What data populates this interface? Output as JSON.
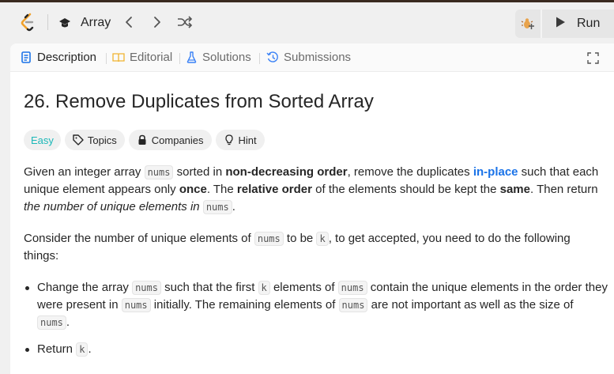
{
  "header": {
    "problem_nav_title": "Array",
    "run_label": "Run",
    "icons": [
      "logo-icon",
      "graduation-cap-icon",
      "chevron-left-icon",
      "chevron-right-icon",
      "shuffle-icon",
      "debug-icon",
      "play-icon"
    ]
  },
  "tabs": [
    {
      "label": "Description",
      "icon": "document-icon",
      "active": true
    },
    {
      "label": "Editorial",
      "icon": "book-icon",
      "active": false
    },
    {
      "label": "Solutions",
      "icon": "flask-icon",
      "active": false
    },
    {
      "label": "Submissions",
      "icon": "history-icon",
      "active": false
    }
  ],
  "problem": {
    "title": "26. Remove Duplicates from Sorted Array",
    "difficulty": "Easy",
    "tags": [
      "Topics",
      "Companies",
      "Hint"
    ]
  },
  "description": {
    "p1": {
      "t1": "Given an integer array ",
      "c1": "nums",
      "t2": " sorted in ",
      "b1": "non-decreasing order",
      "t3": ", remove the duplicates ",
      "link": "in-place",
      "t4": " such that each unique element appears only ",
      "b2": "once",
      "t5": ". The ",
      "b3": "relative order",
      "t6": " of the elements should be kept the ",
      "b4": "same",
      "t7": ". Then return ",
      "i1": "the number of unique elements in ",
      "c2": "nums",
      "t8": "."
    },
    "p2": {
      "t1": "Consider the number of unique elements of ",
      "c1": "nums",
      "t2": " to be ",
      "c2": "k",
      "t3": ", to get accepted, you need to do the following things:"
    },
    "bullet1": {
      "t1": "Change the array ",
      "c1": "nums",
      "t2": " such that the first ",
      "c2": "k",
      "t3": " elements of ",
      "c3": "nums",
      "t4": " contain the unique elements in the order they were present in ",
      "c4": "nums",
      "t5": " initially. The remaining elements of ",
      "c5": "nums",
      "t6": " are not important as well as the size of ",
      "c6": "nums",
      "t7": "."
    },
    "bullet2": {
      "t1": "Return ",
      "c1": "k",
      "t2": "."
    }
  },
  "colors": {
    "accent_blue": "#1a73e8",
    "easy_teal": "#1cb8b8",
    "logo_orange": "#f0a12b"
  }
}
